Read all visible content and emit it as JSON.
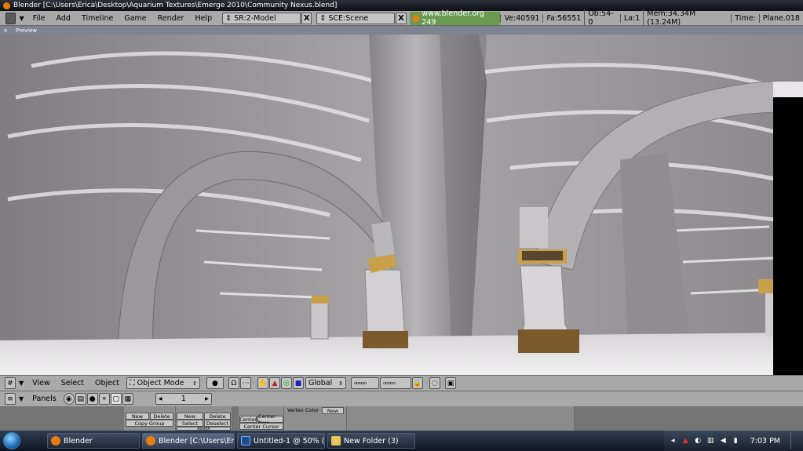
{
  "window": {
    "title": "Blender [C:\\Users\\Erica\\Desktop\\Aquarium Textures\\Emerge 2010\\Community Nexus.blend]"
  },
  "info_header": {
    "menus": [
      "File",
      "Add",
      "Timeline",
      "Game",
      "Render",
      "Help"
    ],
    "screen_field": "SR:2-Model",
    "scene_field": "SCE:Scene",
    "close_glyph": "X",
    "website": "www.blender.org 249",
    "stats": [
      "Ve:40591",
      "Fa:56551",
      "Ob:54-0",
      "La:1",
      "Mem:34.34M (13.24M)",
      "Time:",
      "Plane.018"
    ]
  },
  "preview": {
    "close_glyph": "×",
    "label": "Preview"
  },
  "view_header": {
    "menus": [
      "View",
      "Select",
      "Object"
    ],
    "mode": "Object Mode",
    "orientation": "Global"
  },
  "buttons_header": {
    "label": "Panels",
    "frame_value": "1"
  },
  "buttons": {
    "new": "New",
    "delete": "Delete",
    "copy_group": "Copy Group",
    "new2": "New",
    "delete2": "Delete",
    "select": "Select",
    "deselect": "Deselect",
    "assign": "Assign",
    "center": "Center",
    "center_new": "Center New",
    "center_cursor": "Center Cursor",
    "vertex_color": "Vertex Color",
    "new3": "New"
  },
  "taskbar": {
    "tasks": [
      "Blender",
      "Blender [C:\\Users\\Er...",
      "Untitled-1 @ 50% (L...",
      "New Folder (3)"
    ],
    "clock": "7:03 PM"
  },
  "colors": {
    "blender_orange": "#e87d0d",
    "website_green": "#6a9a50",
    "ui_gray": "#a9a9a9"
  }
}
